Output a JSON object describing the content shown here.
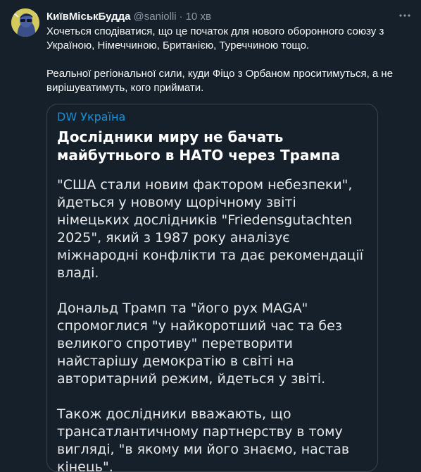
{
  "author": {
    "name": "КиївМіськБудда",
    "handle": "@saniolli",
    "separator": "·",
    "time": "10 хв"
  },
  "tweet": {
    "paragraphs": [
      "Хочеться сподіватися, що це початок для нового оборонного союзу з Україною, Німеччиною, Британією, Туреччиною тощо.",
      "Реальної регіональної сили, куди Фіцо з Орбаном проситимуться, а не вирішуватимуть, кого приймати."
    ]
  },
  "card": {
    "source": "DW Україна",
    "headline": "Дослідники миру не бачать майбутнього в НАТО через Трампа",
    "paragraphs": [
      "\"США стали новим фактором небезпеки\", йдеться у новому щорічному звіті німецьких дослідників \"Friedensgutachten 2025\", який з 1987 року аналізує міжнародні конфлікти та дає рекомендації владі.",
      "Дональд Трамп та \"його рух MAGA\" спромоглися \"у найкоротший час та без великого спротиву\" перетворити найстарішу демократію в світі на авторитарний режим, йдеться у звіті.",
      "Також дослідники вважають, що трансатлантичному партнерству в тому вигляді, \"в якому ми його знаємо, настав кінець\"."
    ]
  },
  "icons": {
    "more": "more-horizontal-icon",
    "avatar": "avatar-image"
  },
  "colors": {
    "background": "#15202b",
    "text": "#f7f9f9",
    "muted": "#8b98a5",
    "card_border": "#38444d",
    "source_link": "#1a8fd6"
  }
}
